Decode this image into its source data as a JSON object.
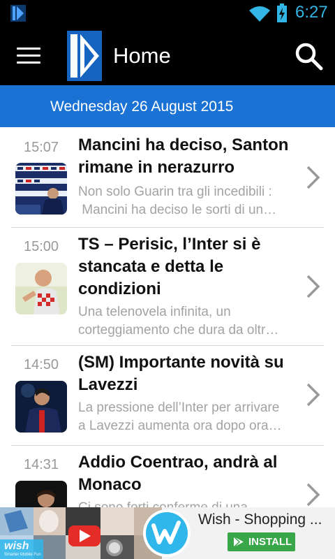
{
  "status_bar": {
    "time": "6:27",
    "icons": [
      "app-notification-icon",
      "wifi-icon",
      "battery-charging-icon"
    ]
  },
  "action_bar": {
    "title": "Home",
    "icons": [
      "menu-icon",
      "app-logo",
      "search-icon"
    ]
  },
  "date_header": "Wednesday 26 August 2015",
  "articles": [
    {
      "time": "15:07",
      "headline_lines": [
        "Mancini ha deciso, Santon",
        "rimane in nerazurro"
      ],
      "excerpt_lines": [
        "Non solo Guarin tra gli incedibili :",
        " Mancini ha deciso le sorti di un…"
      ]
    },
    {
      "time": "15:00",
      "headline_lines": [
        "TS – Perisic, l’Inter si è",
        "stancata e detta le",
        "condizioni"
      ],
      "excerpt_lines": [
        "Una telenovela infinita, un",
        "corteggiamento che dura da oltr…"
      ]
    },
    {
      "time": "14:50",
      "headline_lines": [
        "(SM) Importante novità su",
        "Lavezzi"
      ],
      "excerpt_lines": [
        "La pressione dell’Inter per arrivare",
        "a Lavezzi aumenta ora dopo ora…"
      ]
    },
    {
      "time": "14:31",
      "headline_lines": [
        "Addio Coentrao, andrà al",
        "Monaco"
      ],
      "excerpt_lines": [
        "Ci sono forti conferme di una"
      ]
    }
  ],
  "ad": {
    "title": "Wish - Shopping ...",
    "install_label": "INSTALL",
    "logo_text": "wish",
    "logo_subtext": "Smarter Mobile Fun",
    "accent_color": "#3aa64a",
    "logo_color": "#2fb7ec"
  },
  "colors": {
    "status_icons": "#33b5e5",
    "date_band": "#1a73d4",
    "logo_blue": "#1565c0"
  }
}
